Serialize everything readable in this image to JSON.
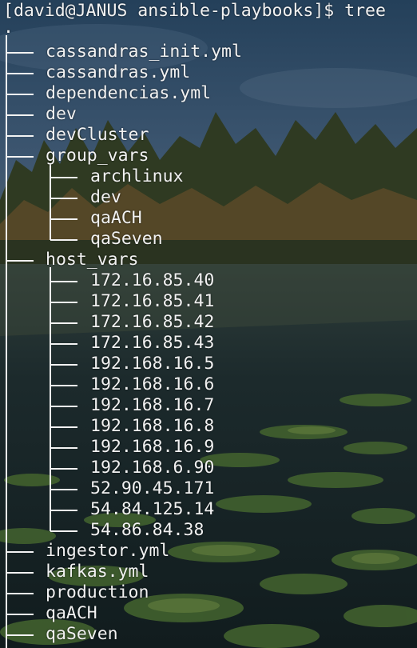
{
  "terminal": {
    "prompt_user": "[david@JANUS ansible-playbooks]$",
    "command": "tree",
    "root": "."
  },
  "tree": [
    {
      "name": "cassandras_init.yml",
      "depth": 0
    },
    {
      "name": "cassandras.yml",
      "depth": 0
    },
    {
      "name": "dependencias.yml",
      "depth": 0
    },
    {
      "name": "dev",
      "depth": 0
    },
    {
      "name": "devCluster",
      "depth": 0
    },
    {
      "name": "group_vars",
      "depth": 0
    },
    {
      "name": "archlinux",
      "depth": 1
    },
    {
      "name": "dev",
      "depth": 1
    },
    {
      "name": "qaACH",
      "depth": 1
    },
    {
      "name": "qaSeven",
      "depth": 1,
      "last": true
    },
    {
      "name": "host_vars",
      "depth": 0
    },
    {
      "name": "172.16.85.40",
      "depth": 1
    },
    {
      "name": "172.16.85.41",
      "depth": 1
    },
    {
      "name": "172.16.85.42",
      "depth": 1
    },
    {
      "name": "172.16.85.43",
      "depth": 1
    },
    {
      "name": "192.168.16.5",
      "depth": 1
    },
    {
      "name": "192.168.16.6",
      "depth": 1
    },
    {
      "name": "192.168.16.7",
      "depth": 1
    },
    {
      "name": "192.168.16.8",
      "depth": 1
    },
    {
      "name": "192.168.16.9",
      "depth": 1
    },
    {
      "name": "192.168.6.90",
      "depth": 1
    },
    {
      "name": "52.90.45.171",
      "depth": 1
    },
    {
      "name": "54.84.125.14",
      "depth": 1
    },
    {
      "name": "54.86.84.38",
      "depth": 1,
      "last": true
    },
    {
      "name": "ingestor.yml",
      "depth": 0
    },
    {
      "name": "kafkas.yml",
      "depth": 0
    },
    {
      "name": "production",
      "depth": 0
    },
    {
      "name": "qaACH",
      "depth": 0
    },
    {
      "name": "qaSeven",
      "depth": 0
    }
  ],
  "colors": {
    "text": "#f2f2f2",
    "sky": "#2c4a66",
    "water": "#16262c",
    "lilypad": "#3f5e2a"
  }
}
